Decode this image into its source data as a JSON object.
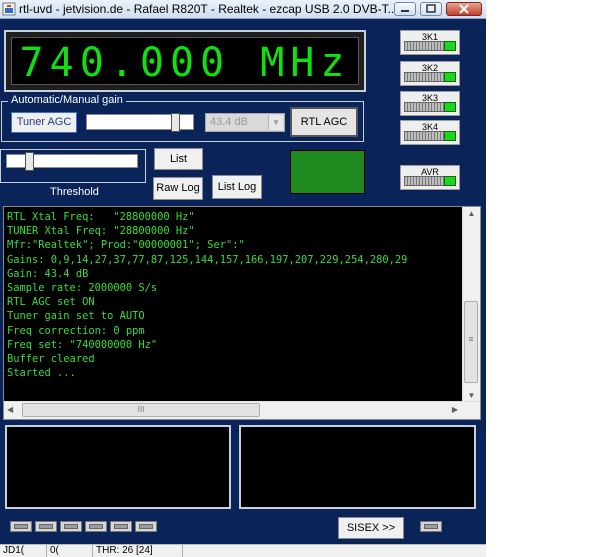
{
  "window": {
    "title": "rtl-uvd - jetvision.de - Rafael R820T - Realtek - ezcap USB 2.0 DVB-T..."
  },
  "frequency": {
    "display": "740.000 MHz",
    "color": "#10e010"
  },
  "channels": [
    {
      "label": "3K1"
    },
    {
      "label": "3K2"
    },
    {
      "label": "3K3"
    },
    {
      "label": "3K4"
    },
    {
      "label": "AVR"
    }
  ],
  "gain": {
    "group_label": "Automatic/Manual gain",
    "tuner_agc_label": "Tuner AGC",
    "db_value": "43.4 dB",
    "rtl_agc_label": "RTL AGC"
  },
  "buttons": {
    "list": "List",
    "raw_log": "Raw Log",
    "list_log": "List Log",
    "sisex": "SISEX >>"
  },
  "threshold": {
    "label": "Threshold"
  },
  "log": {
    "text_color": "#3bdc3b",
    "lines": [
      "RTL Xtal Freq:   \"28800000 Hz\"",
      "TUNER Xtal Freq: \"28800000 Hz\"",
      "Mfr:\"Realtek\"; Prod:\"00000001\"; Ser\":\"",
      "Gains: 0,9,14,27,37,77,87,125,144,157,166,197,207,229,254,280,29",
      "Gain: 43.4 dB",
      "Sample rate: 2000000 S/s",
      "RTL AGC set ON",
      "Tuner gain set to AUTO",
      "Freq correction: 0 ppm",
      "Freq set: \"740000000 Hz\"",
      "Buffer cleared",
      "Started ..."
    ]
  },
  "scroll": {
    "h_grip": "III",
    "v_grip": "≡"
  },
  "status": {
    "cells": [
      "JD1(",
      "0(",
      "THR: 26 [24]"
    ]
  },
  "colors": {
    "window_bg": "#0a2359",
    "green_indicator": "#1f8a1f",
    "led_on": "#1ed61e"
  }
}
